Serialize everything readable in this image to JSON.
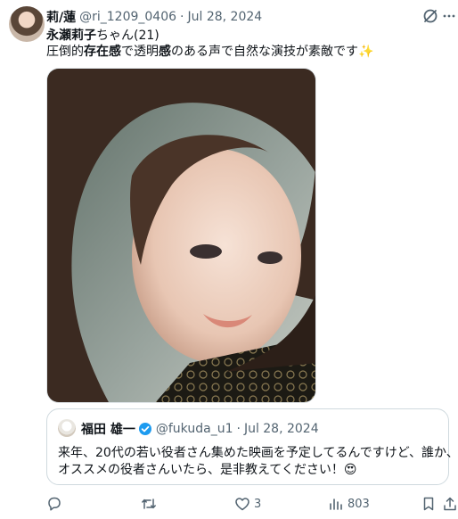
{
  "tweet": {
    "author_name": "莉/蓮",
    "author_handle": "@ri_1209_0406",
    "separator": "·",
    "date": "Jul 28, 2024",
    "line1_name": "永瀬莉子",
    "line1_suffix": "ちゃん(21)",
    "line2_a": "圧倒的",
    "line2_b": "存在感",
    "line2_c": "で透明",
    "line2_d": "感",
    "line2_e": "のある声で自然な演技が素敵です",
    "line2_emoji": "✨"
  },
  "quoted": {
    "author_name": "福田 雄一",
    "author_handle": "@fukuda_u1",
    "separator": "·",
    "date": "Jul 28, 2024",
    "text_line1": "来年、20代の若い役者さん集めた映画を予定してるんですけど、誰か、",
    "text_line2": "オススメの役者さんいたら、是非教えてください！",
    "text_emoji": "😍"
  },
  "actions": {
    "reply_count": "",
    "retweet_count": "",
    "like_count": "3",
    "views_count": "803"
  },
  "icons": [
    "grok-icon",
    "more-icon",
    "verified-icon",
    "reply-icon",
    "retweet-icon",
    "like-icon",
    "views-icon",
    "bookmark-icon",
    "share-icon"
  ],
  "colors": {
    "text": "#0f1419",
    "muted": "#536471",
    "verified": "#1d9bf0",
    "border": "#cfd9de"
  }
}
